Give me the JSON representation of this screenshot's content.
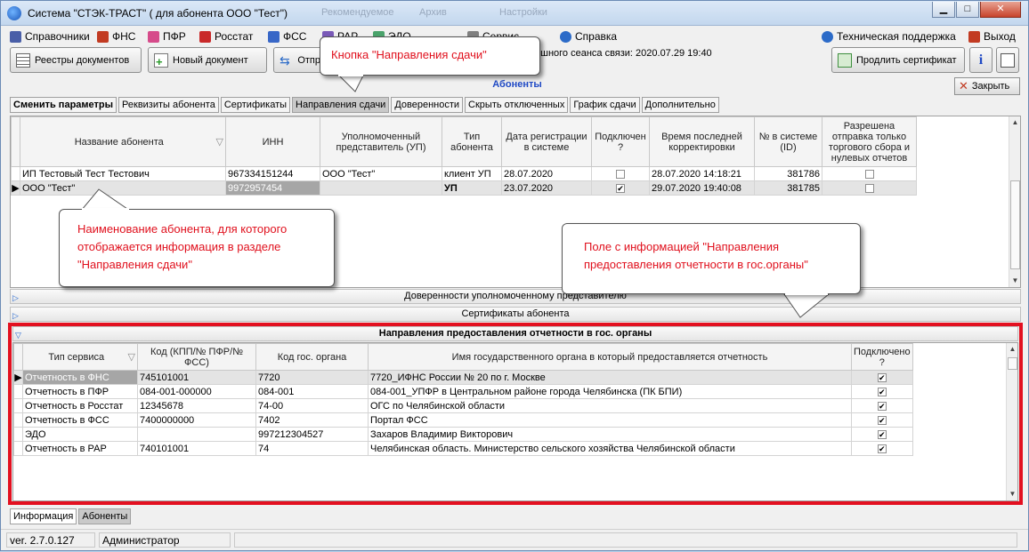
{
  "window": {
    "title": "Система \"СТЭК-ТРАСТ\" ( для абонента ООО \"Тест\")",
    "ghost_labels": [
      "Рекомендуемое",
      "Архив",
      "Настройки"
    ]
  },
  "menu": [
    {
      "label": "Справочники",
      "icon": "book-icon",
      "color": "#4a5fa8"
    },
    {
      "label": "ФНС",
      "icon": "fns-icon",
      "color": "#c23b22"
    },
    {
      "label": "ПФР",
      "icon": "pfr-icon",
      "color": "#d64b8a"
    },
    {
      "label": "Росстат",
      "icon": "rosstat-icon",
      "color": "#c92a2a"
    },
    {
      "label": "ФСС",
      "icon": "fss-icon",
      "color": "#3867c7"
    },
    {
      "label": "РАР",
      "icon": "rar-icon",
      "color": "#7a5ab8"
    },
    {
      "label": "ЭДО",
      "icon": "edo-icon",
      "color": "#4aa36b"
    },
    {
      "label": "Сервис",
      "icon": "service-icon",
      "color": "#808080"
    },
    {
      "label": "Справка",
      "icon": "help-icon",
      "color": "#2c6bc8"
    }
  ],
  "menu_right": [
    {
      "label": "Техническая поддержка",
      "icon": "support-icon",
      "color": "#2c6bc8"
    },
    {
      "label": "Выход",
      "icon": "exit-icon",
      "color": "#c23b22"
    }
  ],
  "toolbar": {
    "registry_label": "Реестры документов",
    "new_doc_label": "Новый документ",
    "send_label": "Отпр",
    "session_text": "ешного сеанса связи: 2020.07.29 19:40",
    "extend_cert_label": "Продлить сертификат"
  },
  "section": {
    "title": "Абоненты",
    "close_label": "Закрыть"
  },
  "tabs": [
    "Сменить параметры",
    "Реквизиты абонента",
    "Сертификаты",
    "Направления сдачи",
    "Доверенности",
    "Скрыть отключенных",
    "График сдачи",
    "Дополнительно"
  ],
  "subscribers": {
    "columns": [
      "Название абонента",
      "ИНН",
      "Уполномоченный представитель (УП)",
      "Тип абонента",
      "Дата регистрации в системе",
      "Подключен ?",
      "Время последней корректировки",
      "№ в системе (ID)",
      "Разрешена отправка только торгового сбора и нулевых отчетов"
    ],
    "rows": [
      {
        "name": "ИП Тестовый Тест Тестович",
        "inn": "967334151244",
        "rep": "ООО \"Тест\"",
        "type": "клиент УП",
        "date": "28.07.2020",
        "connected": false,
        "modified": "28.07.2020 14:18:21",
        "id": "381786",
        "allowed": false
      },
      {
        "name": "ООО \"Тест\"",
        "inn": "9972957454",
        "rep": "",
        "type": "УП",
        "date": "23.07.2020",
        "connected": true,
        "modified": "29.07.2020 19:40:08",
        "id": "381785",
        "allowed": false
      }
    ]
  },
  "panels": {
    "trust": "Доверенности уполномоченному представителю",
    "certs": "Сертификаты абонента",
    "directions": "Направления предоставления отчетности в гос. органы"
  },
  "directions": {
    "columns": [
      "Тип сервиса",
      "Код (КПП/№ ПФР/№ ФСС)",
      "Код гос. органа",
      "Имя государственного органа в который предоставляется отчетность",
      "Подключено ?"
    ],
    "rows": [
      {
        "service": "Отчетность в ФНС",
        "code": "745101001",
        "org_code": "7720",
        "org_name": "7720_ИФНС России № 20 по г. Москве",
        "on": true
      },
      {
        "service": "Отчетность в ПФР",
        "code": "084-001-000000",
        "org_code": "084-001",
        "org_name": "084-001_УПФР в Центральном районе города Челябинска (ПК БПИ)",
        "on": true
      },
      {
        "service": "Отчетность в Росстат",
        "code": "12345678",
        "org_code": "74-00",
        "org_name": "ОГС по Челябинской области",
        "on": true
      },
      {
        "service": "Отчетность в ФСС",
        "code": "7400000000",
        "org_code": "7402",
        "org_name": "Портал ФСС",
        "on": true
      },
      {
        "service": "ЭДО",
        "code": "",
        "org_code": "997212304527",
        "org_name": "Захаров Владимир Викторович",
        "on": true
      },
      {
        "service": "Отчетность в РАР",
        "code": "740101001",
        "org_code": "74",
        "org_name": "Челябинская область. Министерство сельского хозяйства Челябинской области",
        "on": true
      }
    ]
  },
  "callouts": {
    "tab_button": "Кнопка \"Направления сдачи\"",
    "subscriber_name": "Наименование абонента, для которого отображается информация в разделе \"Направления сдачи\"",
    "directions_field": "Поле с информацией \"Направления предоставления отчетности в гос.органы\""
  },
  "bottom_tabs": [
    "Информация",
    "Абоненты"
  ],
  "status": {
    "version": "ver. 2.7.0.127",
    "user": "Администратор"
  },
  "colors": {
    "accent_blue": "#1f49c4",
    "callout_red": "#e0101d",
    "frame_red": "#e31020"
  }
}
